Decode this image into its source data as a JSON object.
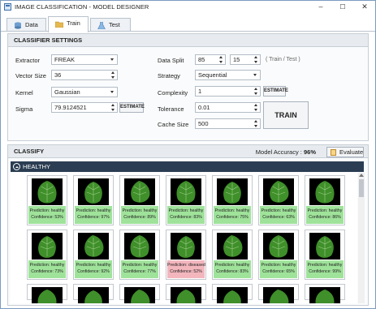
{
  "window": {
    "title": "IMAGE CLASSIFICATION - MODEL DESIGNER",
    "controls": [
      "–",
      "☐",
      "✕"
    ]
  },
  "tabs": [
    {
      "label": "Data",
      "icon": "database-icon",
      "active": false
    },
    {
      "label": "Train",
      "icon": "folder-icon",
      "active": true
    },
    {
      "label": "Test",
      "icon": "flask-icon",
      "active": false
    }
  ],
  "classifier_settings": {
    "header": "CLASSIFIER SETTINGS",
    "extractor": {
      "label": "Extractor",
      "value": "FREAK"
    },
    "vector_size": {
      "label": "Vector Size",
      "value": "36"
    },
    "kernel": {
      "label": "Kernel",
      "value": "Gaussian"
    },
    "sigma": {
      "label": "Sigma",
      "value": "79.9124521",
      "button": "ESTIMATE"
    },
    "data_split": {
      "label": "Data Split",
      "train": "85",
      "test": "15",
      "hint": "( Train / Test )"
    },
    "strategy": {
      "label": "Strategy",
      "value": "Sequential"
    },
    "complexity": {
      "label": "Complexity",
      "value": "1",
      "button": "ESTIMATE"
    },
    "tolerance": {
      "label": "Tolerance",
      "value": "0.01"
    },
    "cache_size": {
      "label": "Cache Size",
      "value": "500"
    },
    "train_button": "TRAIN"
  },
  "classify": {
    "header": "CLASSIFY",
    "accuracy_label": "Model Accuracy :",
    "accuracy_value": "96%",
    "evaluate_button": "Evaluate",
    "group_label": "HEALTHY",
    "cards": [
      {
        "prediction": "Prediction: healthy",
        "confidence": "Confidence: 53%",
        "status": "healthy"
      },
      {
        "prediction": "Prediction: healthy",
        "confidence": "Confidence: 97%",
        "status": "healthy"
      },
      {
        "prediction": "Prediction: healthy",
        "confidence": "Confidence: 89%",
        "status": "healthy"
      },
      {
        "prediction": "Prediction: healthy",
        "confidence": "Confidence: 83%",
        "status": "healthy"
      },
      {
        "prediction": "Prediction: healthy",
        "confidence": "Confidence: 75%",
        "status": "healthy"
      },
      {
        "prediction": "Prediction: healthy",
        "confidence": "Confidence: 63%",
        "status": "healthy"
      },
      {
        "prediction": "Prediction: healthy",
        "confidence": "Confidence: 86%",
        "status": "healthy"
      },
      {
        "prediction": "Prediction: healthy",
        "confidence": "Confidence: 73%",
        "status": "healthy"
      },
      {
        "prediction": "Prediction: healthy",
        "confidence": "Confidence: 92%",
        "status": "healthy"
      },
      {
        "prediction": "Prediction: healthy",
        "confidence": "Confidence: 77%",
        "status": "healthy"
      },
      {
        "prediction": "Prediction: diseased",
        "confidence": "Confidence: 52%",
        "status": "diseased"
      },
      {
        "prediction": "Prediction: healthy",
        "confidence": "Confidence: 83%",
        "status": "healthy"
      },
      {
        "prediction": "Prediction: healthy",
        "confidence": "Confidence: 65%",
        "status": "healthy"
      },
      {
        "prediction": "Prediction: healthy",
        "confidence": "Confidence: 99%",
        "status": "healthy"
      }
    ]
  },
  "colors": {
    "healthy": "#9fe39a",
    "diseased": "#f3b6bd",
    "group_header": "#2b3d52",
    "leaf_green": "#3f8f2a"
  }
}
